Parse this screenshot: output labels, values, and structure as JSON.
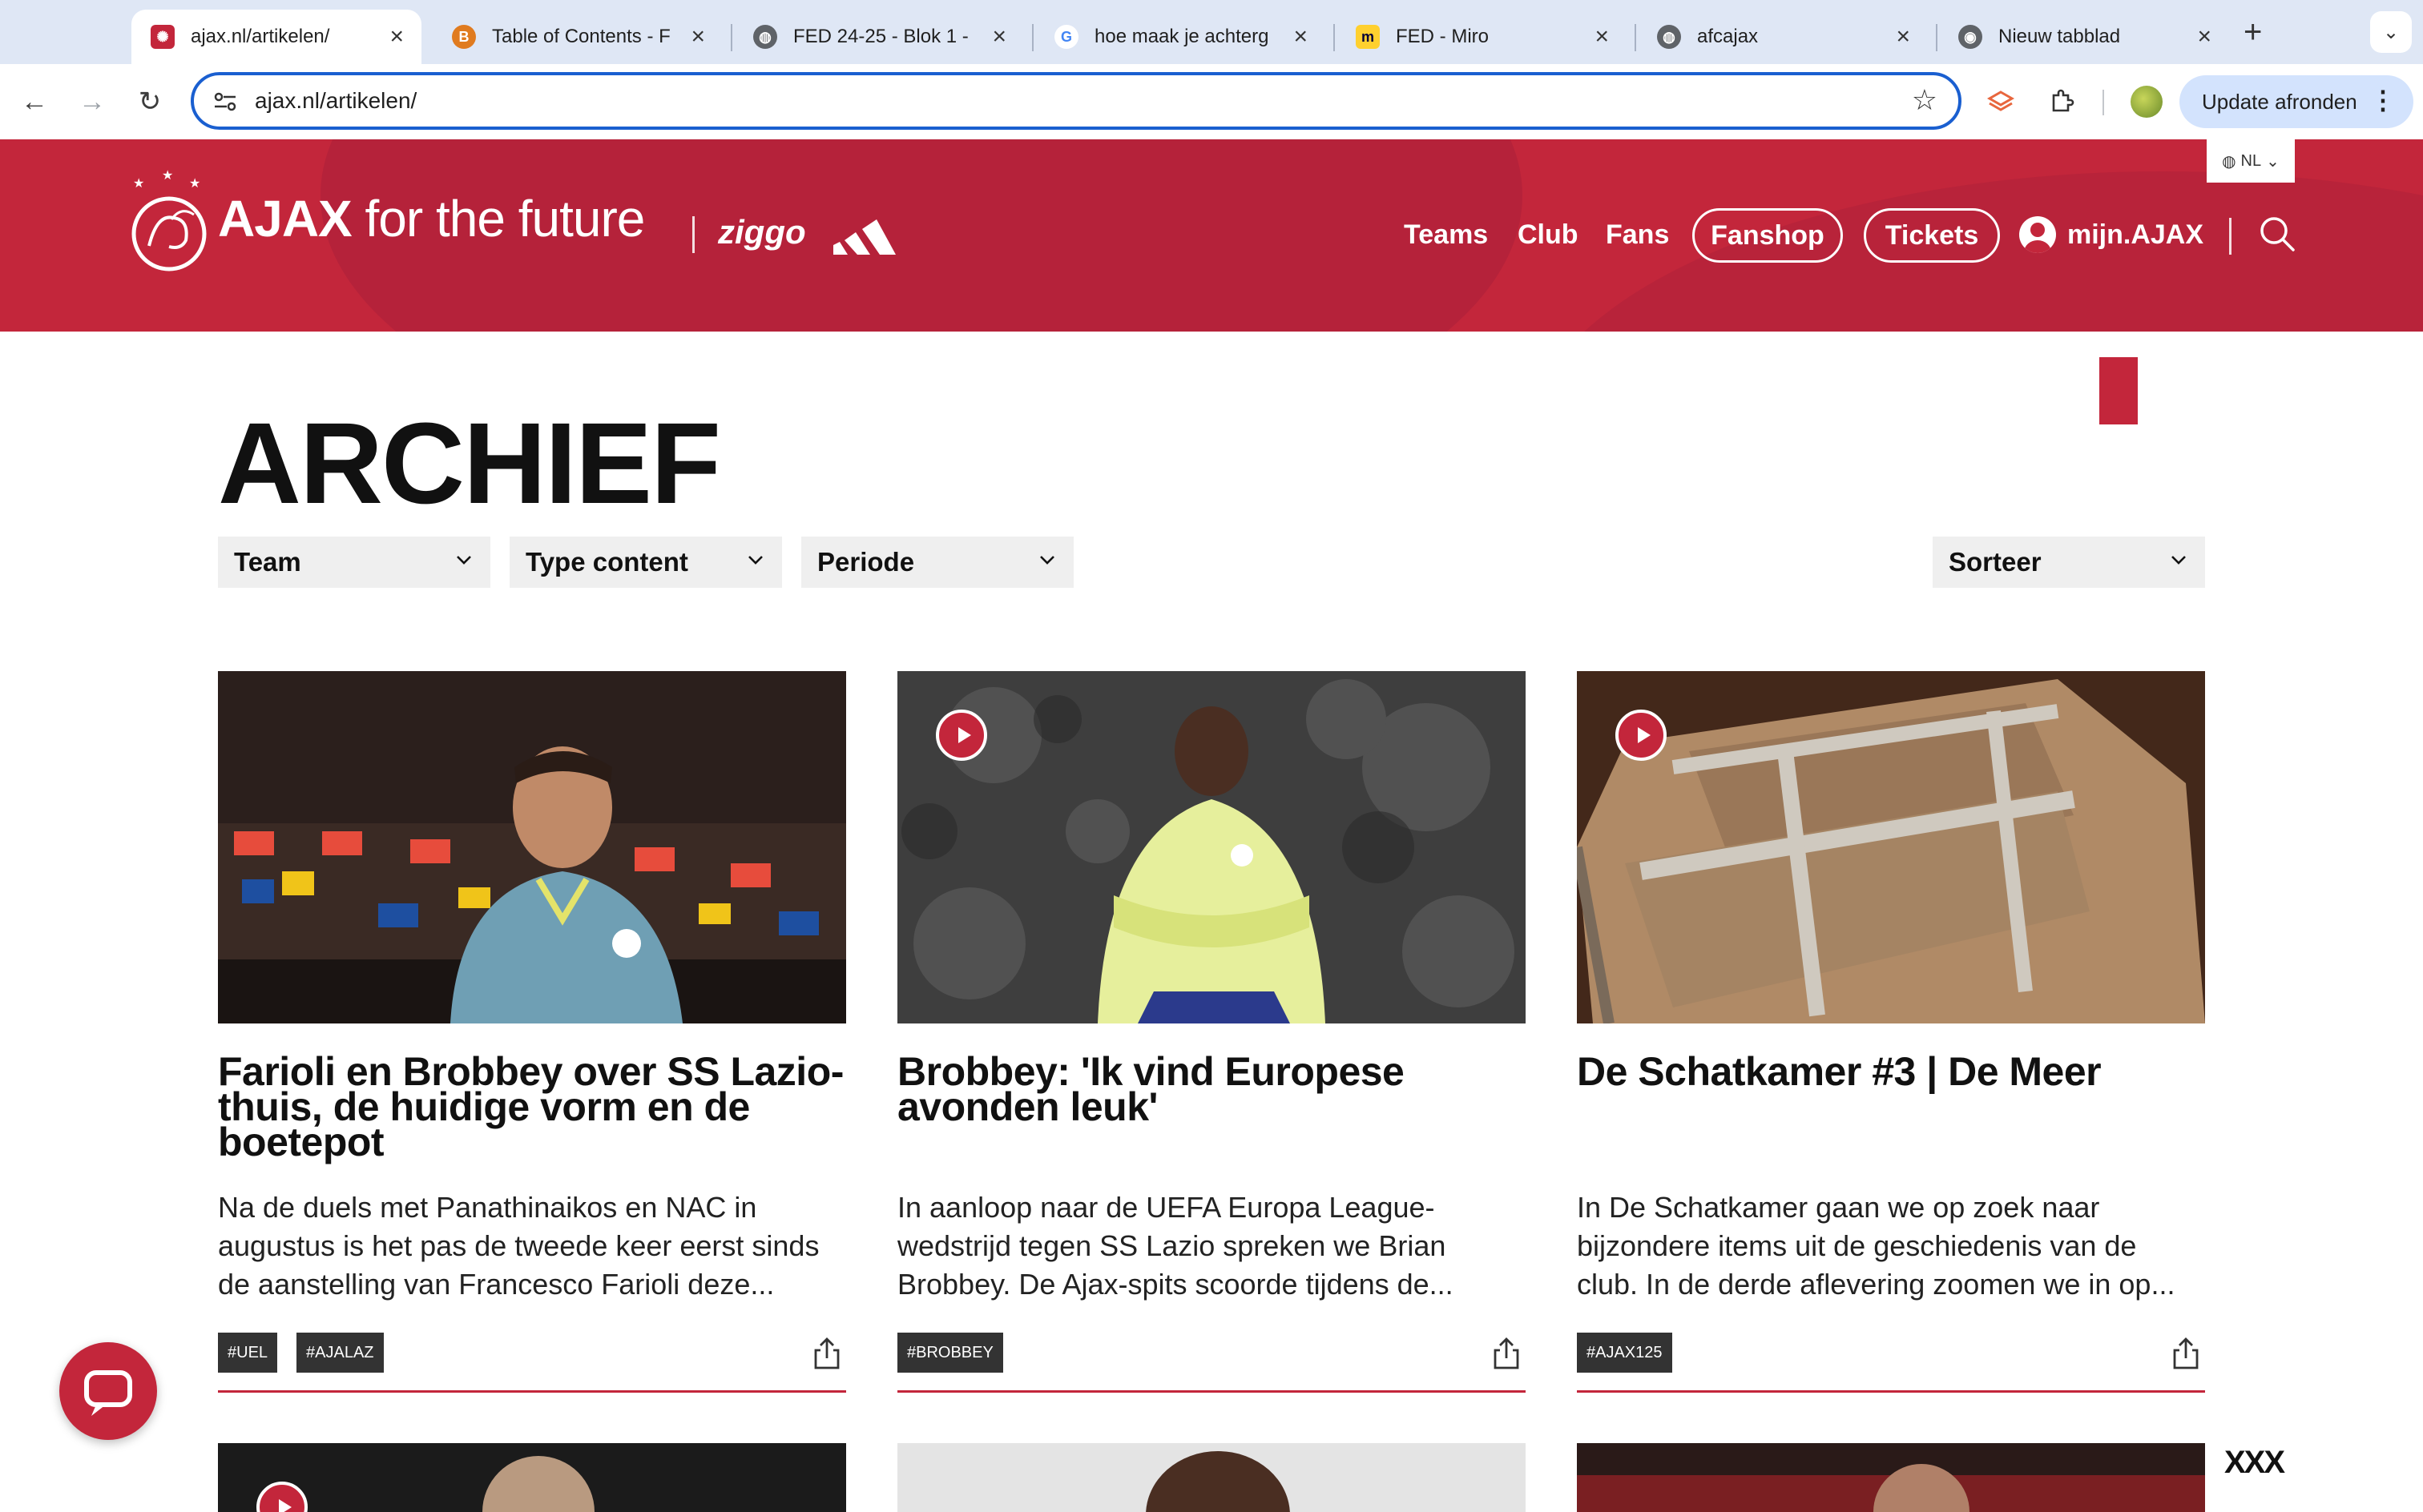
{
  "browser": {
    "tabs": [
      {
        "title": "ajax.nl/artikelen/",
        "active": true,
        "icon": "ajax-favicon"
      },
      {
        "title": "Table of Contents - F",
        "active": false,
        "icon": "book-favicon"
      },
      {
        "title": "FED 24-25 - Blok 1 -",
        "active": false,
        "icon": "globe-favicon"
      },
      {
        "title": "hoe maak je achterg",
        "active": false,
        "icon": "google-favicon"
      },
      {
        "title": "FED - Miro",
        "active": false,
        "icon": "miro-favicon"
      },
      {
        "title": "afcajax",
        "active": false,
        "icon": "globe-favicon"
      },
      {
        "title": "Nieuw tabblad",
        "active": false,
        "icon": "chrome-favicon"
      }
    ],
    "new_tab_label": "+",
    "url": "ajax.nl/artikelen/",
    "update_button": "Update afronden"
  },
  "header": {
    "brand_bold": "AJAX",
    "brand_rest": " for the future",
    "sponsor": "ziggo",
    "language": "NL",
    "nav": [
      "Teams",
      "Club",
      "Fans"
    ],
    "pills": [
      "Fanshop",
      "Tickets"
    ],
    "account": "mijn.AJAX",
    "colors": {
      "brand_red": "#c3263b"
    }
  },
  "page": {
    "title": "ARCHIEF",
    "filters": [
      "Team",
      "Type content",
      "Periode"
    ],
    "sort": "Sorteer"
  },
  "articles": [
    {
      "title": "Farioli en Brobbey over SS Lazio-thuis, de huidige vorm en de boetepot",
      "summary": "Na de duels met Panathinaikos en NAC in augustus is het pas de tweede keer eerst sinds de aanstelling van Francesco Farioli deze...",
      "tags": [
        "#UEL",
        "#AJALAZ"
      ],
      "video": false
    },
    {
      "title": "Brobbey: 'Ik vind Europese avonden leuk'",
      "summary": "In aanloop naar de UEFA Europa League-wedstrijd tegen SS Lazio spreken we Brian Brobbey. De Ajax-spits scoorde tijdens de...",
      "tags": [
        "#BROBBEY"
      ],
      "video": true
    },
    {
      "title": "De Schatkamer #3 | De Meer",
      "summary": "In De Schatkamer gaan we op zoek naar bijzondere items uit de geschiedenis van de club. In de derde aflevering zoomen we in op...",
      "tags": [
        "#AJAX125"
      ],
      "video": true
    }
  ],
  "footer_mark": "XXX"
}
